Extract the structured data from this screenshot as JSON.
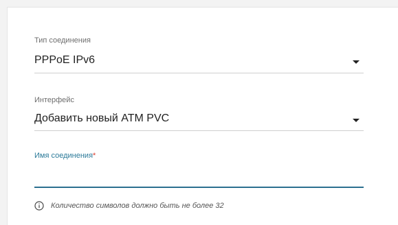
{
  "form": {
    "connection_type": {
      "label": "Тип соединения",
      "value": "PPPoE IPv6",
      "icon": "chevron-down-icon"
    },
    "interface": {
      "label": "Интерфейс",
      "value": "Добавить новый ATM PVC",
      "icon": "chevron-down-icon"
    },
    "connection_name": {
      "label": "Имя соединения",
      "required_mark": "*",
      "value": ""
    },
    "hint": {
      "icon": "info-icon",
      "text": "Количество символов должно быть не более 32"
    }
  },
  "colors": {
    "accent": "#2a6f8f",
    "label_accent": "#2b7a99",
    "required": "#d93a2b",
    "divider": "#cfcfcf"
  }
}
